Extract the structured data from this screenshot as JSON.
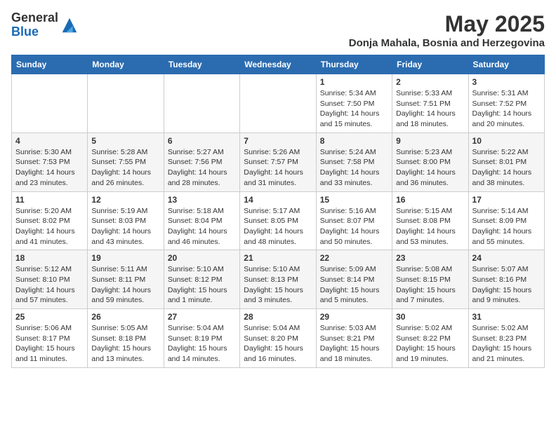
{
  "header": {
    "logo_line1": "General",
    "logo_line2": "Blue",
    "month_title": "May 2025",
    "location": "Donja Mahala, Bosnia and Herzegovina"
  },
  "days_of_week": [
    "Sunday",
    "Monday",
    "Tuesday",
    "Wednesday",
    "Thursday",
    "Friday",
    "Saturday"
  ],
  "weeks": [
    [
      {
        "day": "",
        "info": ""
      },
      {
        "day": "",
        "info": ""
      },
      {
        "day": "",
        "info": ""
      },
      {
        "day": "",
        "info": ""
      },
      {
        "day": "1",
        "info": "Sunrise: 5:34 AM\nSunset: 7:50 PM\nDaylight: 14 hours\nand 15 minutes."
      },
      {
        "day": "2",
        "info": "Sunrise: 5:33 AM\nSunset: 7:51 PM\nDaylight: 14 hours\nand 18 minutes."
      },
      {
        "day": "3",
        "info": "Sunrise: 5:31 AM\nSunset: 7:52 PM\nDaylight: 14 hours\nand 20 minutes."
      }
    ],
    [
      {
        "day": "4",
        "info": "Sunrise: 5:30 AM\nSunset: 7:53 PM\nDaylight: 14 hours\nand 23 minutes."
      },
      {
        "day": "5",
        "info": "Sunrise: 5:28 AM\nSunset: 7:55 PM\nDaylight: 14 hours\nand 26 minutes."
      },
      {
        "day": "6",
        "info": "Sunrise: 5:27 AM\nSunset: 7:56 PM\nDaylight: 14 hours\nand 28 minutes."
      },
      {
        "day": "7",
        "info": "Sunrise: 5:26 AM\nSunset: 7:57 PM\nDaylight: 14 hours\nand 31 minutes."
      },
      {
        "day": "8",
        "info": "Sunrise: 5:24 AM\nSunset: 7:58 PM\nDaylight: 14 hours\nand 33 minutes."
      },
      {
        "day": "9",
        "info": "Sunrise: 5:23 AM\nSunset: 8:00 PM\nDaylight: 14 hours\nand 36 minutes."
      },
      {
        "day": "10",
        "info": "Sunrise: 5:22 AM\nSunset: 8:01 PM\nDaylight: 14 hours\nand 38 minutes."
      }
    ],
    [
      {
        "day": "11",
        "info": "Sunrise: 5:20 AM\nSunset: 8:02 PM\nDaylight: 14 hours\nand 41 minutes."
      },
      {
        "day": "12",
        "info": "Sunrise: 5:19 AM\nSunset: 8:03 PM\nDaylight: 14 hours\nand 43 minutes."
      },
      {
        "day": "13",
        "info": "Sunrise: 5:18 AM\nSunset: 8:04 PM\nDaylight: 14 hours\nand 46 minutes."
      },
      {
        "day": "14",
        "info": "Sunrise: 5:17 AM\nSunset: 8:05 PM\nDaylight: 14 hours\nand 48 minutes."
      },
      {
        "day": "15",
        "info": "Sunrise: 5:16 AM\nSunset: 8:07 PM\nDaylight: 14 hours\nand 50 minutes."
      },
      {
        "day": "16",
        "info": "Sunrise: 5:15 AM\nSunset: 8:08 PM\nDaylight: 14 hours\nand 53 minutes."
      },
      {
        "day": "17",
        "info": "Sunrise: 5:14 AM\nSunset: 8:09 PM\nDaylight: 14 hours\nand 55 minutes."
      }
    ],
    [
      {
        "day": "18",
        "info": "Sunrise: 5:12 AM\nSunset: 8:10 PM\nDaylight: 14 hours\nand 57 minutes."
      },
      {
        "day": "19",
        "info": "Sunrise: 5:11 AM\nSunset: 8:11 PM\nDaylight: 14 hours\nand 59 minutes."
      },
      {
        "day": "20",
        "info": "Sunrise: 5:10 AM\nSunset: 8:12 PM\nDaylight: 15 hours\nand 1 minute."
      },
      {
        "day": "21",
        "info": "Sunrise: 5:10 AM\nSunset: 8:13 PM\nDaylight: 15 hours\nand 3 minutes."
      },
      {
        "day": "22",
        "info": "Sunrise: 5:09 AM\nSunset: 8:14 PM\nDaylight: 15 hours\nand 5 minutes."
      },
      {
        "day": "23",
        "info": "Sunrise: 5:08 AM\nSunset: 8:15 PM\nDaylight: 15 hours\nand 7 minutes."
      },
      {
        "day": "24",
        "info": "Sunrise: 5:07 AM\nSunset: 8:16 PM\nDaylight: 15 hours\nand 9 minutes."
      }
    ],
    [
      {
        "day": "25",
        "info": "Sunrise: 5:06 AM\nSunset: 8:17 PM\nDaylight: 15 hours\nand 11 minutes."
      },
      {
        "day": "26",
        "info": "Sunrise: 5:05 AM\nSunset: 8:18 PM\nDaylight: 15 hours\nand 13 minutes."
      },
      {
        "day": "27",
        "info": "Sunrise: 5:04 AM\nSunset: 8:19 PM\nDaylight: 15 hours\nand 14 minutes."
      },
      {
        "day": "28",
        "info": "Sunrise: 5:04 AM\nSunset: 8:20 PM\nDaylight: 15 hours\nand 16 minutes."
      },
      {
        "day": "29",
        "info": "Sunrise: 5:03 AM\nSunset: 8:21 PM\nDaylight: 15 hours\nand 18 minutes."
      },
      {
        "day": "30",
        "info": "Sunrise: 5:02 AM\nSunset: 8:22 PM\nDaylight: 15 hours\nand 19 minutes."
      },
      {
        "day": "31",
        "info": "Sunrise: 5:02 AM\nSunset: 8:23 PM\nDaylight: 15 hours\nand 21 minutes."
      }
    ]
  ]
}
